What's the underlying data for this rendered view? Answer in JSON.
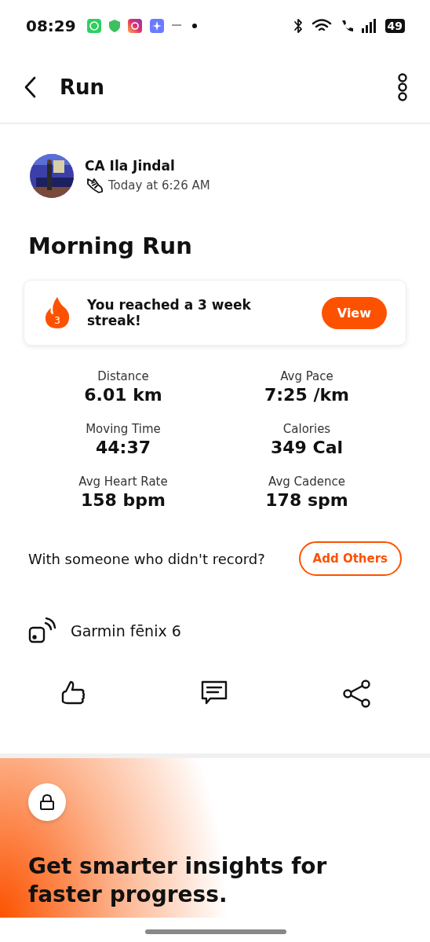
{
  "status_bar": {
    "time": "08:29",
    "battery": "49"
  },
  "header": {
    "title": "Run"
  },
  "athlete": {
    "name": "CA Ila Jindal",
    "time": "Today at 6:26 AM"
  },
  "activity": {
    "title": "Morning Run"
  },
  "streak": {
    "count": "3",
    "message": "You reached a 3 week streak!",
    "button": "View"
  },
  "stats": [
    {
      "label": "Distance",
      "value": "6.01 km"
    },
    {
      "label": "Avg Pace",
      "value": "7:25 /km"
    },
    {
      "label": "Moving Time",
      "value": "44:37"
    },
    {
      "label": "Calories",
      "value": "349 Cal"
    },
    {
      "label": "Avg Heart Rate",
      "value": "158 bpm"
    },
    {
      "label": "Avg Cadence",
      "value": "178 spm"
    }
  ],
  "others": {
    "prompt": "With someone who didn't record?",
    "button": "Add Others"
  },
  "device": {
    "name": "Garmin fēnix 6"
  },
  "promo": {
    "title": "Get smarter insights for faster progress."
  }
}
